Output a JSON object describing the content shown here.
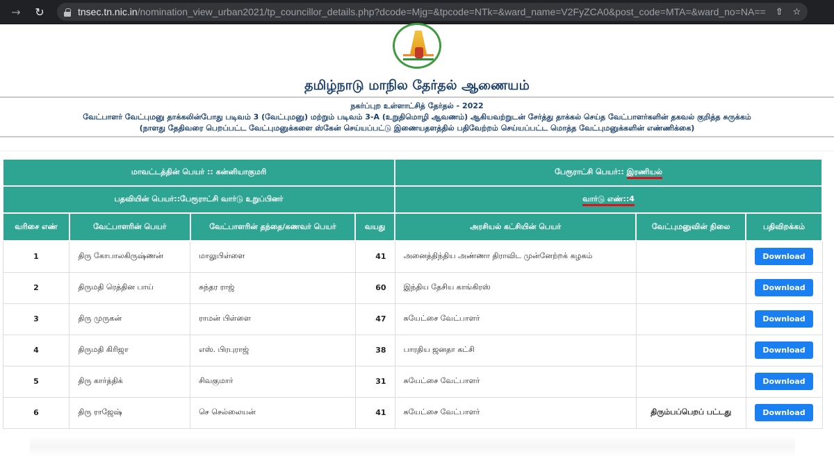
{
  "browser": {
    "url_host": "tnsec.tn.nic.in",
    "url_path": "/nomination_view_urban2021/tp_councillor_details.php?dcode=Mjg=&tpcode=NTk=&ward_name=V2FyZCA0&post_code=MTA=&ward_no=NA==",
    "icons": [
      "forward-arrow-icon",
      "reload-icon",
      "lock-icon",
      "share-icon",
      "star-icon"
    ]
  },
  "header": {
    "logo_alt": "Tamil Nadu Government emblem",
    "title": "தமிழ்நாடு மாநில தேர்தல் ஆணையம்",
    "election_line": "நகர்ப்புற உள்ளாட்சித் தேர்தல் - 2022",
    "description_line": "வேட்பாளர் வேட்புமனு தாக்கலின்போது படிவம் 3 (வேட்புமனு) மற்றும் படிவம் 3-A (உறுதிமொழி ஆவணம்) ஆகியவற்றுடன் சேர்த்து தாக்கல் செய்த வேட்பாளர்களின் தகவல் குறித்த சுருக்கம்",
    "note_line": "(நாளது தேதிவரை பெறப்பட்ட வேட்புமனுக்களை ஸ்கேன் செய்யப்பட்டு இணையதளத்தில் பதிவேற்றம் செய்யப்பட்ட மொத்த வேட்புமனுக்களின் எண்ணிக்கை)"
  },
  "info": {
    "district_label": "மாவட்டத்தின் பெயர் :: ",
    "district_value": "கன்னியாகுமரி",
    "town_panchayat_label": "பேரூராட்சி பெயர்:: ",
    "town_panchayat_value": "இரணியல்",
    "post_label": "பதவியின் பெயர்::",
    "post_value": "பேரூராட்சி வார்டு உறுப்பினர்",
    "ward_label": "வார்டு எண்::",
    "ward_value": "4"
  },
  "table": {
    "columns": [
      "வரிசை எண்",
      "வேட்பாளரின் பெயர்",
      "வேட்பாளரின் தந்தை/கணவர் பெயர்",
      "வயது",
      "அரசியல் கட்சியின் பெயர்",
      "வேட்புமனுவின் நிலை",
      "பதிவிறக்கம்"
    ],
    "download_label": "Download",
    "rows": [
      {
        "sno": "1",
        "name": "திரு கோபாலகிருஷ்ணன்",
        "relative": "மாலுபிள்ளை",
        "age": "41",
        "party": "அனைத்திந்திய அண்ணா திராவிட முன்னேற்றக் கழகம்",
        "status": ""
      },
      {
        "sno": "2",
        "name": "திருமதி ரெத்தின பாய்",
        "relative": "சுந்தர ராஜ்",
        "age": "60",
        "party": "இந்திய தேசிய காங்கிரஸ்",
        "status": ""
      },
      {
        "sno": "3",
        "name": "திரு முருகன்",
        "relative": "ராமன் பிள்ளை",
        "age": "47",
        "party": "சுயேட்சை வேட்பாளர்",
        "status": ""
      },
      {
        "sno": "4",
        "name": "திருமதி கிரிஜா",
        "relative": "எஸ். பிரபுராஜ்",
        "age": "38",
        "party": "பாரதிய ஜனதா கட்சி",
        "status": ""
      },
      {
        "sno": "5",
        "name": "திரு கார்த்திக்",
        "relative": "சிவகுமார்",
        "age": "31",
        "party": "சுயேட்சை வேட்பாளர்",
        "status": ""
      },
      {
        "sno": "6",
        "name": "திரு ராஜேஷ்",
        "relative": "செ செல்லையன்",
        "age": "41",
        "party": "சுயேட்சை வேட்பாளர்",
        "status": "திரும்பப்பெறப் பட்டது"
      }
    ]
  },
  "colors": {
    "header_teal": "#2ea593",
    "title_navy": "#1a3f6b",
    "download_blue": "#1a7ff0",
    "status_red": "#e0101a",
    "highlight_underline": "#e0101a"
  }
}
